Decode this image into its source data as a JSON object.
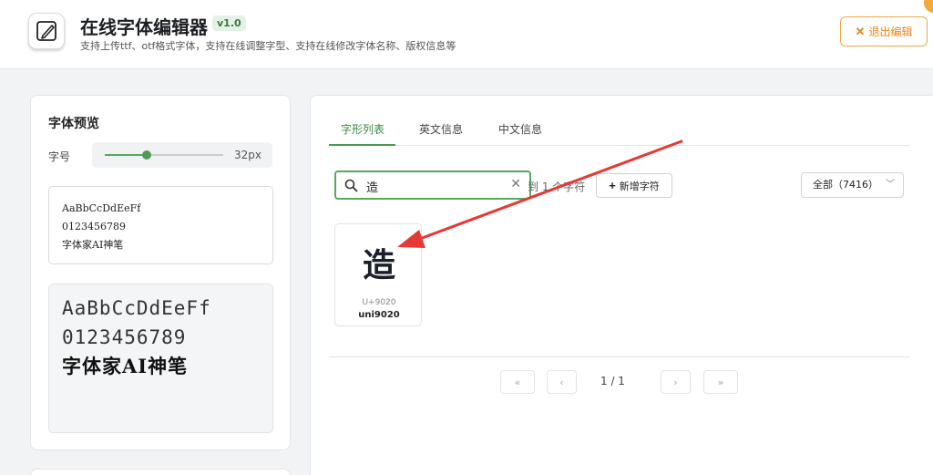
{
  "header": {
    "title": "在线字体编辑器",
    "version": "v1.0",
    "subtitle": "支持上传ttf、otf格式字体，支持在线调整字型、支持在线修改字体名称、版权信息等",
    "exit_label": "退出编辑",
    "logo_icon": "pencil-square-icon",
    "accent_color": "#4a9b50",
    "warning_color": "#e8861b"
  },
  "preview_panel": {
    "title": "字体预览",
    "size_label": "字号",
    "size_value": "32px",
    "slider_fraction": 0.35,
    "sample_text": "AaBbCcDdEeFf\n0123456789\n字体家AI神笔",
    "preview_lines": [
      "AaBbCcDdEeFf",
      "0123456789",
      "字体家AI神笔"
    ]
  },
  "editor": {
    "tabs": [
      {
        "label": "字形列表",
        "active": true
      },
      {
        "label": "英文信息",
        "active": false
      },
      {
        "label": "中文信息",
        "active": false
      }
    ],
    "search": {
      "value": "造",
      "icon": "search-icon"
    },
    "result_text": "到 1 个字符",
    "add_button_label": "新增字符",
    "filter": {
      "selected": "全部（7416）"
    },
    "glyphs": [
      {
        "char": "造",
        "code": "U+9020",
        "name": "uni9020"
      }
    ],
    "pagination": {
      "first": "«",
      "prev": "‹",
      "indicator": "1 / 1",
      "next": "›",
      "last": "»"
    }
  },
  "annotation": {
    "arrow_color": "#e53935"
  }
}
